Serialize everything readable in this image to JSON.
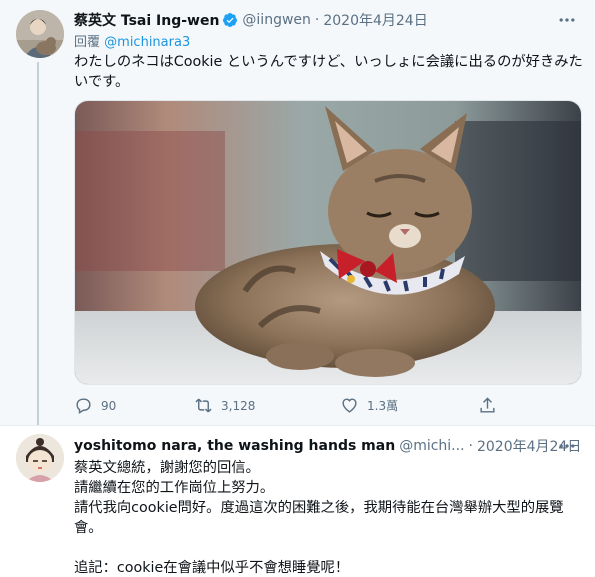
{
  "tweet": {
    "author": {
      "display_name": "蔡英文 Tsai Ing-wen",
      "handle": "@iingwen",
      "verified": true
    },
    "date": "2020年4月24日",
    "reply_to_prefix": "回覆",
    "reply_to_handle": "@michinara3",
    "text": "わたしのネコはCookie というんですけど、いっしょに会議に出るのが好きみたいです。",
    "media": {
      "alt": "cat photo",
      "icon": "photo"
    },
    "stats": {
      "replies": "90",
      "retweets": "3,128",
      "likes": "1.3萬"
    }
  },
  "reply": {
    "author": {
      "display_name": "yoshitomo nara, the washing hands man",
      "handle": "@michi..."
    },
    "date": "2020年4月24日",
    "lines": [
      "蔡英文總統，謝謝您的回信。",
      "請繼續在您的工作崗位上努力。",
      "請代我向cookie問好。度過這次的困難之後，我期待能在台灣舉辦大型的展覽會。",
      "",
      "追記：cookie在會議中似乎不會想睡覺呢！"
    ]
  },
  "separator": "·",
  "colors": {
    "accent": "#1da1f2",
    "muted": "#5b7083",
    "background": "#f5f8fa"
  }
}
